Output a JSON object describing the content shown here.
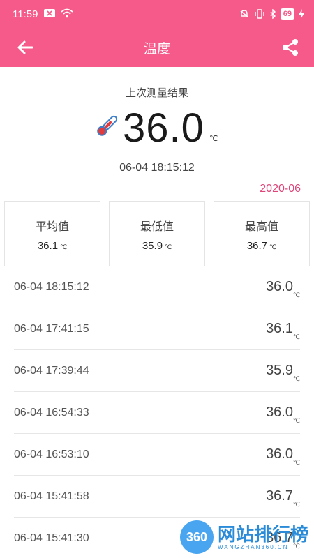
{
  "status_bar": {
    "time": "11:59",
    "battery": "69"
  },
  "app_bar": {
    "title": "温度"
  },
  "summary": {
    "caption": "上次测量结果",
    "value": "36.0",
    "unit": "℃",
    "time": "06-04 18:15:12",
    "month": "2020-06"
  },
  "stats": [
    {
      "label": "平均值",
      "value": "36.1",
      "unit": "℃"
    },
    {
      "label": "最低值",
      "value": "35.9",
      "unit": "℃"
    },
    {
      "label": "最高值",
      "value": "36.7",
      "unit": "℃"
    }
  ],
  "records": [
    {
      "time": "06-04 18:15:12",
      "value": "36.0",
      "unit": "℃"
    },
    {
      "time": "06-04 17:41:15",
      "value": "36.1",
      "unit": "℃"
    },
    {
      "time": "06-04 17:39:44",
      "value": "35.9",
      "unit": "℃"
    },
    {
      "time": "06-04 16:54:33",
      "value": "36.0",
      "unit": "℃"
    },
    {
      "time": "06-04 16:53:10",
      "value": "36.0",
      "unit": "℃"
    },
    {
      "time": "06-04 15:41:58",
      "value": "36.7",
      "unit": "℃"
    },
    {
      "time": "06-04 15:41:30",
      "value": "36.7",
      "unit": "℃"
    }
  ],
  "watermark": {
    "logo": "360",
    "brand": "网站排行榜",
    "site": "WANGZHAN360.CN"
  },
  "icons": {
    "back": "arrow-left-icon",
    "share": "share-icon",
    "thermometer": "thermometer-icon"
  },
  "colors": {
    "accent": "#f65a8a",
    "month": "#e0457a"
  }
}
